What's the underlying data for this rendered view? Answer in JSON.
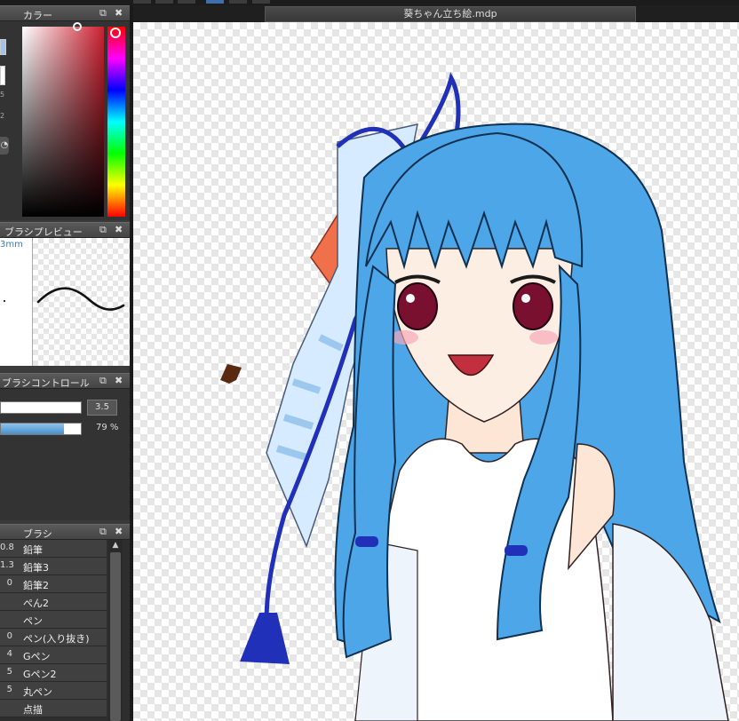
{
  "document": {
    "tab_title": "葵ちゃん立ち絵.mdp"
  },
  "color_panel": {
    "title": "カラー",
    "side_values": [
      "5",
      "2"
    ],
    "colors": {
      "hue_accent": "#cc2030",
      "current_primary": "#a0c4f0",
      "current_secondary": "#ffffff"
    }
  },
  "brush_preview_panel": {
    "title": "ブラシプレビュー",
    "size_label": "3mm"
  },
  "brush_control_panel": {
    "title": "ブラシコントロール",
    "size_value": "3.5",
    "opacity_value": "79 %",
    "opacity_fraction": 0.79
  },
  "brush_panel": {
    "title": "ブラシ",
    "items": [
      {
        "size": "0.8",
        "name": "鉛筆"
      },
      {
        "size": "1.3",
        "name": "鉛筆3"
      },
      {
        "size": "0",
        "name": "鉛筆2"
      },
      {
        "size": "",
        "name": "ぺん2"
      },
      {
        "size": "",
        "name": "ペン"
      },
      {
        "size": "0",
        "name": "ペン(入り抜き)"
      },
      {
        "size": "4",
        "name": "Gペン"
      },
      {
        "size": "5",
        "name": "Gペン2"
      },
      {
        "size": "5",
        "name": "丸ペン"
      },
      {
        "size": "",
        "name": "点描"
      }
    ]
  }
}
